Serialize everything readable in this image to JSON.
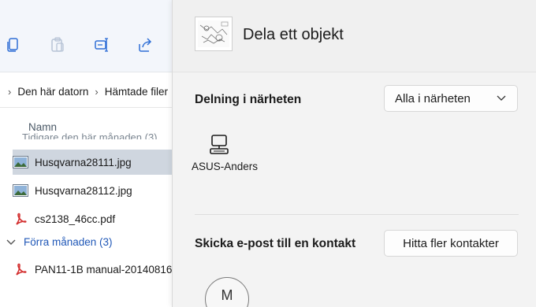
{
  "explorer": {
    "toolbar": {
      "icons": [
        "copy-icon",
        "paste-icon",
        "rename-icon",
        "share-icon"
      ]
    },
    "breadcrumb": [
      "Den här datorn",
      "Hämtade filer"
    ],
    "column_header": "Namn",
    "ghost_row": "Tidigare den här månaden (3)",
    "files": [
      {
        "name": "Husqvarna28111.jpg",
        "type": "image",
        "selected": true
      },
      {
        "name": "Husqvarna28112.jpg",
        "type": "image",
        "selected": false
      },
      {
        "name": "cs2138_46cc.pdf",
        "type": "pdf",
        "selected": false
      }
    ],
    "group": {
      "label": "Förra månaden (3)"
    },
    "group_files": [
      {
        "name": "PAN11-1B manual-20140816",
        "type": "pdf"
      }
    ]
  },
  "share": {
    "title": "Dela ett objekt",
    "nearby": {
      "label": "Delning i närheten",
      "dropdown_value": "Alla i närheten",
      "devices": [
        {
          "name": "ASUS-Anders",
          "icon": "computer-icon"
        }
      ]
    },
    "email": {
      "label": "Skicka e-post till en kontakt",
      "button": "Hitta fler kontakter",
      "contacts": [
        {
          "initial": "M"
        }
      ]
    }
  },
  "colors": {
    "selection": "#cfd6df",
    "group_blue": "#1f57b7",
    "panel_bg": "#f3f3f3",
    "pdf_red": "#d32f2f"
  }
}
